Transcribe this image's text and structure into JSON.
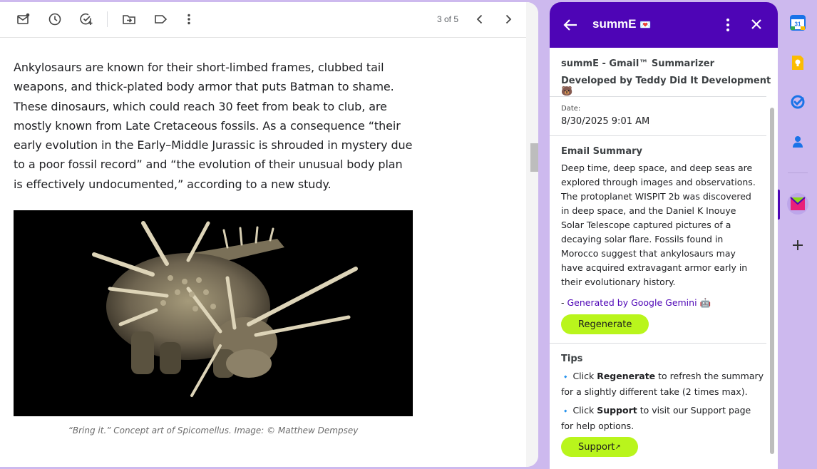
{
  "toolbar": {
    "icons": [
      "mark-unread-icon",
      "snooze-icon",
      "add-task-icon",
      "move-to-icon",
      "label-icon",
      "more-vert-icon"
    ],
    "pager_text": "3 of 5",
    "prev_icon": "chevron-left-icon",
    "next_icon": "chevron-right-icon"
  },
  "article": {
    "paragraph": "Ankylosaurs are known for their short-limbed frames, clubbed tail weapons, and thick-plated body armor that puts Batman to shame. These dinosaurs, which could reach 30 feet from beak to club, are mostly known from Late Cretaceous fossils. As a consequence “their early evolution in the Early–Middle Jurassic is shrouded in mystery due to a poor fossil record” and “the evolution of their unusual body plan is effectively undocumented,” according to a new study.",
    "caption": "“Bring it.” Concept art of Spicomellus. Image: © Matthew Dempsey"
  },
  "panel": {
    "title": "summE",
    "title_emoji": "💌",
    "app_name": "summE - Gmail™ Summarizer",
    "developer": "Developed by Teddy Did It Development",
    "developer_emoji": "🐻",
    "date_label": "Date:",
    "date_value": "8/30/2025 9:01 AM",
    "summary_heading": "Email Summary",
    "summary_text": "Deep time, deep space, and deep seas are explored through images and observations. The protoplanet WISPIT 2b was discovered in deep space, and the Daniel K Inouye Solar Telescope captured pictures of a decaying solar flare. Fossils found in Morocco suggest that ankylosaurs may have acquired extravagant armor early in their evolutionary history.",
    "generated_prefix": "- ",
    "generated_link": "Generated by Google Gemini",
    "generated_emoji": "🤖",
    "regenerate_label": "Regenerate",
    "tips_heading": "Tips",
    "tip1": {
      "pre": "Click ",
      "bold": "Regenerate",
      "post": " to refresh the summary for a slightly different take (2 times max)."
    },
    "tip2": {
      "pre": "Click ",
      "bold": "Support",
      "post": " to visit our Support page for help options."
    },
    "tip_bullet": "🔹",
    "support_label": "Support",
    "support_arrow": "↗"
  },
  "rail": {
    "calendar_day": "31",
    "items": [
      "calendar-icon",
      "keep-icon",
      "tasks-icon",
      "contacts-icon",
      "summe-addon-icon",
      "add-addon-icon"
    ]
  },
  "colors": {
    "panel_header": "#4e05b6",
    "button_green": "#b9f51c",
    "background": "#cdb9ee"
  }
}
